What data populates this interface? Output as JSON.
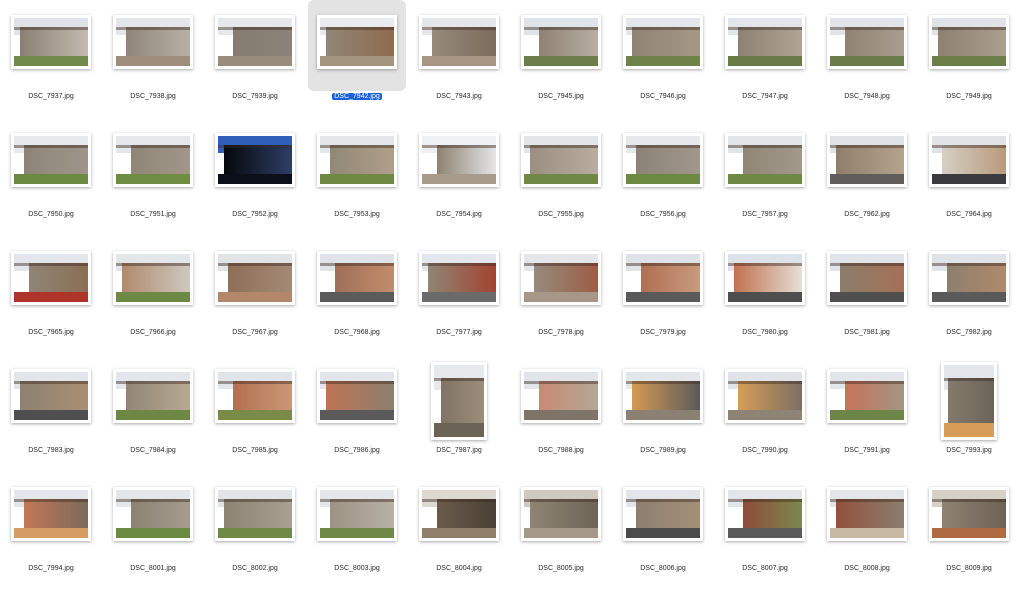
{
  "selected_file": "DSC_7942.jpg",
  "files": [
    {
      "name": "DSC_7937.jpg",
      "orientation": "landscape",
      "palette": [
        "#dfe3e8",
        "#8a7f72",
        "#6f8a4a",
        "#c4bbb0"
      ]
    },
    {
      "name": "DSC_7938.jpg",
      "orientation": "landscape",
      "palette": [
        "#e4e6ea",
        "#8f8578",
        "#9d8d7a",
        "#b9b0a5"
      ]
    },
    {
      "name": "DSC_7939.jpg",
      "orientation": "landscape",
      "palette": [
        "#e6e8ec",
        "#857b70",
        "#9a8c7c",
        "#8b8379"
      ]
    },
    {
      "name": "DSC_7942.jpg",
      "orientation": "landscape",
      "palette": [
        "#e9ebee",
        "#918676",
        "#a39480",
        "#8f6b4f"
      ]
    },
    {
      "name": "DSC_7943.jpg",
      "orientation": "landscape",
      "palette": [
        "#e5e7ea",
        "#958a7b",
        "#a69683",
        "#7c6b5a"
      ]
    },
    {
      "name": "DSC_7945.jpg",
      "orientation": "landscape",
      "palette": [
        "#dfe4ea",
        "#8d8273",
        "#6b7d48",
        "#b8aea2"
      ]
    },
    {
      "name": "DSC_7946.jpg",
      "orientation": "landscape",
      "palette": [
        "#e3e6ea",
        "#8f8474",
        "#6f8248",
        "#a49886"
      ]
    },
    {
      "name": "DSC_7947.jpg",
      "orientation": "landscape",
      "palette": [
        "#e2e5e9",
        "#8c8172",
        "#687a46",
        "#b0a595"
      ]
    },
    {
      "name": "DSC_7948.jpg",
      "orientation": "landscape",
      "palette": [
        "#e1e4e8",
        "#8e8373",
        "#6a7c47",
        "#a99e8f"
      ]
    },
    {
      "name": "DSC_7949.jpg",
      "orientation": "landscape",
      "palette": [
        "#dfe3e7",
        "#8b8071",
        "#6c7e47",
        "#ab9f8f"
      ]
    },
    {
      "name": "DSC_7950.jpg",
      "orientation": "landscape",
      "palette": [
        "#e7e9ec",
        "#8c8577",
        "#6b8a3f",
        "#9e968a"
      ]
    },
    {
      "name": "DSC_7951.jpg",
      "orientation": "landscape",
      "palette": [
        "#e5e8eb",
        "#8f8677",
        "#6f8c43",
        "#a0978a"
      ]
    },
    {
      "name": "DSC_7952.jpg",
      "orientation": "landscape",
      "palette": [
        "#2f5fb8",
        "#05070c",
        "#0b0f1a",
        "#2d3e66"
      ]
    },
    {
      "name": "DSC_7953.jpg",
      "orientation": "landscape",
      "palette": [
        "#e4e7ea",
        "#918877",
        "#6e8a42",
        "#b09f8a"
      ]
    },
    {
      "name": "DSC_7954.jpg",
      "orientation": "landscape",
      "palette": [
        "#eef0f2",
        "#8d8272",
        "#a79b8c",
        "#e6e6e6"
      ]
    },
    {
      "name": "DSC_7955.jpg",
      "orientation": "landscape",
      "palette": [
        "#e3e6e9",
        "#9a8f80",
        "#6f8846",
        "#b8ada0"
      ]
    },
    {
      "name": "DSC_7956.jpg",
      "orientation": "landscape",
      "palette": [
        "#e6e9ec",
        "#8b8375",
        "#6b8a3f",
        "#a1988b"
      ]
    },
    {
      "name": "DSC_7957.jpg",
      "orientation": "landscape",
      "palette": [
        "#e2e5e8",
        "#8f8676",
        "#6e8943",
        "#a3998b"
      ]
    },
    {
      "name": "DSC_7962.jpg",
      "orientation": "landscape",
      "palette": [
        "#dfe3e7",
        "#8e7f6c",
        "#5f5e5c",
        "#b5a38c"
      ]
    },
    {
      "name": "DSC_7964.jpg",
      "orientation": "landscape",
      "palette": [
        "#e1e4e7",
        "#d6cfc5",
        "#3b3b3d",
        "#b89a7c"
      ]
    },
    {
      "name": "DSC_7965.jpg",
      "orientation": "landscape",
      "palette": [
        "#e3e6ea",
        "#8f8575",
        "#b0332a",
        "#8b6f55"
      ]
    },
    {
      "name": "DSC_7966.jpg",
      "orientation": "landscape",
      "palette": [
        "#e4e7ea",
        "#b08a6e",
        "#6e8946",
        "#cfc8bf"
      ]
    },
    {
      "name": "DSC_7967.jpg",
      "orientation": "landscape",
      "palette": [
        "#e2e5e8",
        "#8e6f58",
        "#b2876a",
        "#a38a75"
      ]
    },
    {
      "name": "DSC_7968.jpg",
      "orientation": "landscape",
      "palette": [
        "#e0e4e8",
        "#a06f58",
        "#5b5b5b",
        "#c28d6e"
      ]
    },
    {
      "name": "DSC_7977.jpg",
      "orientation": "landscape",
      "palette": [
        "#e3e6ea",
        "#8f8676",
        "#6b6b6b",
        "#a3432f"
      ]
    },
    {
      "name": "DSC_7978.jpg",
      "orientation": "landscape",
      "palette": [
        "#e4e6e9",
        "#958b7c",
        "#a69787",
        "#9e5c44"
      ]
    },
    {
      "name": "DSC_7979.jpg",
      "orientation": "landscape",
      "palette": [
        "#dfe3e8",
        "#b06e54",
        "#5a5a5a",
        "#c99b7e"
      ]
    },
    {
      "name": "DSC_7980.jpg",
      "orientation": "landscape",
      "palette": [
        "#dee3e9",
        "#c0714f",
        "#4e4e4e",
        "#e5e0d8"
      ]
    },
    {
      "name": "DSC_7981.jpg",
      "orientation": "landscape",
      "palette": [
        "#e1e5e9",
        "#8a7d6c",
        "#4f4f4f",
        "#a67055"
      ]
    },
    {
      "name": "DSC_7982.jpg",
      "orientation": "landscape",
      "palette": [
        "#e0e4e8",
        "#8c7f6d",
        "#5a5a5a",
        "#b18a6c"
      ]
    },
    {
      "name": "DSC_7983.jpg",
      "orientation": "landscape",
      "palette": [
        "#e2e5e9",
        "#8d8171",
        "#4f4f4f",
        "#a98f74"
      ]
    },
    {
      "name": "DSC_7984.jpg",
      "orientation": "landscape",
      "palette": [
        "#e3e6ea",
        "#918676",
        "#6e8744",
        "#b7a993"
      ]
    },
    {
      "name": "DSC_7985.jpg",
      "orientation": "landscape",
      "palette": [
        "#e1e5e9",
        "#b4704f",
        "#7a8a48",
        "#c99877"
      ]
    },
    {
      "name": "DSC_7986.jpg",
      "orientation": "landscape",
      "palette": [
        "#e2e6ea",
        "#bf7352",
        "#5a5a5a",
        "#8b7f70"
      ]
    },
    {
      "name": "DSC_7987.jpg",
      "orientation": "portrait",
      "palette": [
        "#e7eaed",
        "#807466",
        "#6b6356",
        "#9c8d7a"
      ]
    },
    {
      "name": "DSC_7988.jpg",
      "orientation": "landscape",
      "palette": [
        "#e1e4e8",
        "#c98a73",
        "#7f7468",
        "#b3a898"
      ]
    },
    {
      "name": "DSC_7989.jpg",
      "orientation": "landscape",
      "palette": [
        "#e4e7ea",
        "#d59a52",
        "#8a8172",
        "#5a5a5a"
      ]
    },
    {
      "name": "DSC_7990.jpg",
      "orientation": "landscape",
      "palette": [
        "#e0e3e7",
        "#d79c57",
        "#8d8475",
        "#7a6f62"
      ]
    },
    {
      "name": "DSC_7991.jpg",
      "orientation": "landscape",
      "palette": [
        "#e2e5e9",
        "#c8735a",
        "#6d8546",
        "#a29684"
      ]
    },
    {
      "name": "DSC_7993.jpg",
      "orientation": "portrait",
      "palette": [
        "#e3e6ea",
        "#857a6c",
        "#d79c57",
        "#6c6458"
      ]
    },
    {
      "name": "DSC_7994.jpg",
      "orientation": "landscape",
      "palette": [
        "#e3e6ea",
        "#c27756",
        "#d59d63",
        "#7a6a5b"
      ]
    },
    {
      "name": "DSC_8001.jpg",
      "orientation": "landscape",
      "palette": [
        "#e4e7ea",
        "#8b8272",
        "#6b8a43",
        "#a79d8f"
      ]
    },
    {
      "name": "DSC_8002.jpg",
      "orientation": "landscape",
      "palette": [
        "#e2e5e8",
        "#8d8373",
        "#6f8a45",
        "#a9a093"
      ]
    },
    {
      "name": "DSC_8003.jpg",
      "orientation": "landscape",
      "palette": [
        "#e5e7ea",
        "#9d9384",
        "#6e8946",
        "#b8b1a7"
      ]
    },
    {
      "name": "DSC_8004.jpg",
      "orientation": "landscape",
      "palette": [
        "#ddd8d0",
        "#6a5b4b",
        "#8f7e6a",
        "#4a4036"
      ]
    },
    {
      "name": "DSC_8005.jpg",
      "orientation": "landscape",
      "palette": [
        "#cfc9bf",
        "#8f8575",
        "#a5998a",
        "#6d6456"
      ]
    },
    {
      "name": "DSC_8006.jpg",
      "orientation": "landscape",
      "palette": [
        "#e2e5e9",
        "#8d8070",
        "#4b4b4b",
        "#a48f77"
      ]
    },
    {
      "name": "DSC_8007.jpg",
      "orientation": "landscape",
      "palette": [
        "#e3e6e9",
        "#8e4a3a",
        "#5b5b5b",
        "#7b8a4c"
      ]
    },
    {
      "name": "DSC_8008.jpg",
      "orientation": "landscape",
      "palette": [
        "#e3e6e9",
        "#92503b",
        "#c8b9a5",
        "#8b7f70"
      ]
    },
    {
      "name": "DSC_8009.jpg",
      "orientation": "landscape",
      "palette": [
        "#d6d0c6",
        "#8e8272",
        "#b06a42",
        "#6d6255"
      ]
    }
  ]
}
